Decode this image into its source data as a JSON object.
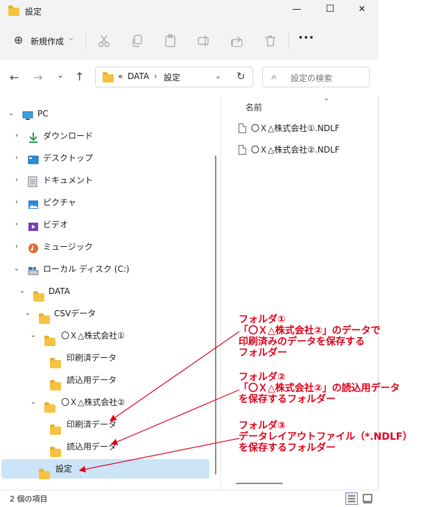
{
  "window": {
    "title": "設定",
    "minimize": "—",
    "maximize": "☐",
    "close": "✕"
  },
  "toolbar": {
    "new_label": "新規作成",
    "new_plus": "⊕",
    "new_chevron": "⌄",
    "more": "···"
  },
  "nav": {
    "back": "←",
    "forward": "→",
    "recent": "⌄",
    "up": "↑",
    "breadcrumb_prefix": "«",
    "crumbs": [
      "DATA",
      "設定"
    ],
    "crumb_sep": "›",
    "dropdown": "⌄",
    "refresh": "↻",
    "search_placeholder": "設定の検索",
    "search_icon": "⌕"
  },
  "tree": [
    {
      "label": "PC",
      "icon": "pc-icon",
      "chev": "⌄"
    },
    {
      "label": "ダウンロード",
      "icon": "download-icon",
      "chev": "›"
    },
    {
      "label": "デスクトップ",
      "icon": "desktop-icon",
      "chev": "›"
    },
    {
      "label": "ドキュメント",
      "icon": "documents-icon",
      "chev": "›"
    },
    {
      "label": "ピクチャ",
      "icon": "pictures-icon",
      "chev": "›"
    },
    {
      "label": "ビデオ",
      "icon": "videos-icon",
      "chev": "›"
    },
    {
      "label": "ミュージック",
      "icon": "music-icon",
      "chev": "›"
    },
    {
      "label": "ローカル ディスク (C:)",
      "icon": "disk-icon",
      "chev": "⌄"
    },
    {
      "label": "DATA",
      "icon": "folder-icon",
      "chev": "⌄"
    },
    {
      "label": "CSVデータ",
      "icon": "folder-icon",
      "chev": "⌄"
    },
    {
      "label": "〇Ｘ△株式会社①",
      "icon": "folder-icon",
      "chev": "⌄"
    },
    {
      "label": "印刷済データ",
      "icon": "folder-icon",
      "chev": ""
    },
    {
      "label": "読込用データ",
      "icon": "folder-icon",
      "chev": ""
    },
    {
      "label": "〇Ｘ△株式会社②",
      "icon": "folder-icon",
      "chev": "⌄"
    },
    {
      "label": "印刷済データ",
      "icon": "folder-icon",
      "chev": ""
    },
    {
      "label": "読込用データ",
      "icon": "folder-icon",
      "chev": ""
    },
    {
      "label": "設定",
      "icon": "folder-icon",
      "chev": "",
      "selected": true
    }
  ],
  "files": {
    "column_name": "名前",
    "sort_arrow": "⌃",
    "items": [
      "〇Ｘ△株式会社①.NDLF",
      "〇Ｘ△株式会社②.NDLF"
    ]
  },
  "status": {
    "count": "2 個の項目"
  },
  "annotations": [
    [
      "フォルダ①",
      "「〇Ｘ△株式会社②」のデータで",
      "印刷済みのデータを保存する",
      "フォルダー"
    ],
    [
      "フォルダ②",
      "「〇Ｘ△株式会社②」の読込用データ",
      "を保存するフォルダー"
    ],
    [
      "フォルダ③",
      "データレイアウトファイル（*.NDLF）",
      "を保存するフォルダー"
    ]
  ],
  "colors": {
    "annotation": "#e0001a",
    "selection": "#cce4f7",
    "folder": "#f5c241"
  }
}
